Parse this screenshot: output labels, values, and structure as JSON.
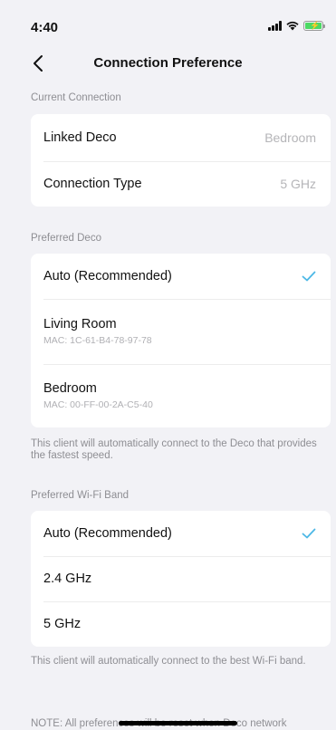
{
  "status_bar": {
    "time": "4:40",
    "icons": [
      "signal-icon",
      "wifi-icon",
      "battery-charging-icon"
    ],
    "battery_color": "#4cd964"
  },
  "nav": {
    "title": "Connection Preference",
    "back_icon": "chevron-left-icon"
  },
  "current_connection": {
    "header": "Current Connection",
    "rows": [
      {
        "label": "Linked Deco",
        "value": "Bedroom"
      },
      {
        "label": "Connection Type",
        "value": "5 GHz"
      }
    ]
  },
  "preferred_deco": {
    "header": "Preferred Deco",
    "options": [
      {
        "label": "Auto (Recommended)",
        "sub": "",
        "selected": true
      },
      {
        "label": "Living Room",
        "sub": "MAC: 1C-61-B4-78-97-78",
        "selected": false
      },
      {
        "label": "Bedroom",
        "sub": "MAC: 00-FF-00-2A-C5-40",
        "selected": false
      }
    ],
    "note": "This client will automatically connect to the Deco that provides the fastest speed."
  },
  "preferred_band": {
    "header": "Preferred Wi-Fi Band",
    "options": [
      {
        "label": "Auto (Recommended)",
        "selected": true
      },
      {
        "label": "2.4 GHz",
        "selected": false
      },
      {
        "label": "5 GHz",
        "selected": false
      }
    ],
    "note": "This client will automatically connect to the best Wi-Fi band."
  },
  "bottom_note": "NOTE: All preferences will be reset when Deco network",
  "colors": {
    "accent": "#4db8e6",
    "background": "#f2f2f6",
    "secondary_text": "#8e8e93"
  }
}
